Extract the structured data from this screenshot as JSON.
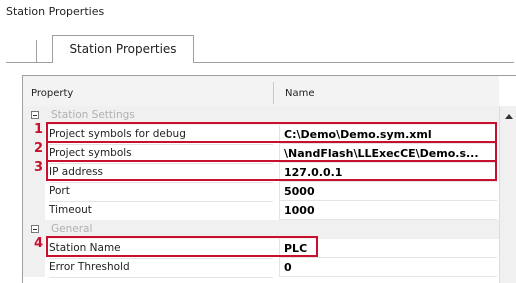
{
  "window": {
    "title": "Station Properties"
  },
  "tab": {
    "label": "Station Properties"
  },
  "grid": {
    "col_property": "Property",
    "col_name": "Name",
    "categories": {
      "station_settings": "Station Settings",
      "general": "General"
    },
    "rows": [
      {
        "property": "Project symbols for debug",
        "value": "C:\\Demo\\Demo.sym.xml"
      },
      {
        "property": "Project symbols",
        "value": "\\NandFlash\\LLExecCE\\Demo.s..."
      },
      {
        "property": "IP address",
        "value": "127.0.0.1"
      },
      {
        "property": "Port",
        "value": "5000"
      },
      {
        "property": "Timeout",
        "value": "1000"
      },
      {
        "property": "Station Name",
        "value": "PLC"
      },
      {
        "property": "Error Threshold",
        "value": "0"
      }
    ]
  },
  "callouts": [
    "1",
    "2",
    "3",
    "4"
  ],
  "colors": {
    "highlight": "#c8102e",
    "category_text": "#b0b0b0"
  }
}
